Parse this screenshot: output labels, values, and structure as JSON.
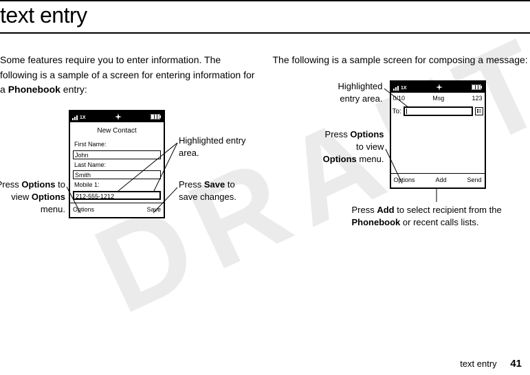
{
  "heading": "text entry",
  "left_intro_a": "Some features require you to enter information. The following is a sample of a screen for entering information for a ",
  "left_intro_b": "Phonebook",
  "left_intro_c": " entry:",
  "right_intro": "The following is a sample screen for composing a message:",
  "phone1": {
    "status_signal": "1X",
    "title": "New Contact",
    "first_label": "First Name:",
    "first_value": "John",
    "last_label": "Last Name:",
    "last_value": "Smith",
    "mobile_label": "Mobile 1:",
    "mobile_value": "212-555-1212",
    "soft_left": "Options",
    "soft_right": "Save"
  },
  "callout1a_a": "Press ",
  "callout1a_b": "Options",
  "callout1a_c": " to view ",
  "callout1a_d": "Options",
  "callout1a_e": " menu.",
  "callout1b": "Highlighted entry area.",
  "callout1c_a": "Press ",
  "callout1c_b": "Save",
  "callout1c_c": " to save changes.",
  "phone2": {
    "status_signal": "1X",
    "bar_left": "0/10",
    "bar_mid": "Msg",
    "bar_right": "123",
    "to_label": "To:",
    "soft_left": "Options",
    "soft_mid": "Add",
    "soft_right": "Send"
  },
  "callout2a": "Highlighted entry area.",
  "callout2b_a": "Press ",
  "callout2b_b": "Options",
  "callout2b_c": " to view",
  "callout2b_d": "Options",
  "callout2b_e": " menu.",
  "callout2c_a": "Press ",
  "callout2c_b": "Add",
  "callout2c_c": " to select recipient from the ",
  "callout2c_d": "Phonebook",
  "callout2c_e": " or recent calls lists.",
  "footer_text": "text entry",
  "footer_page": "41"
}
